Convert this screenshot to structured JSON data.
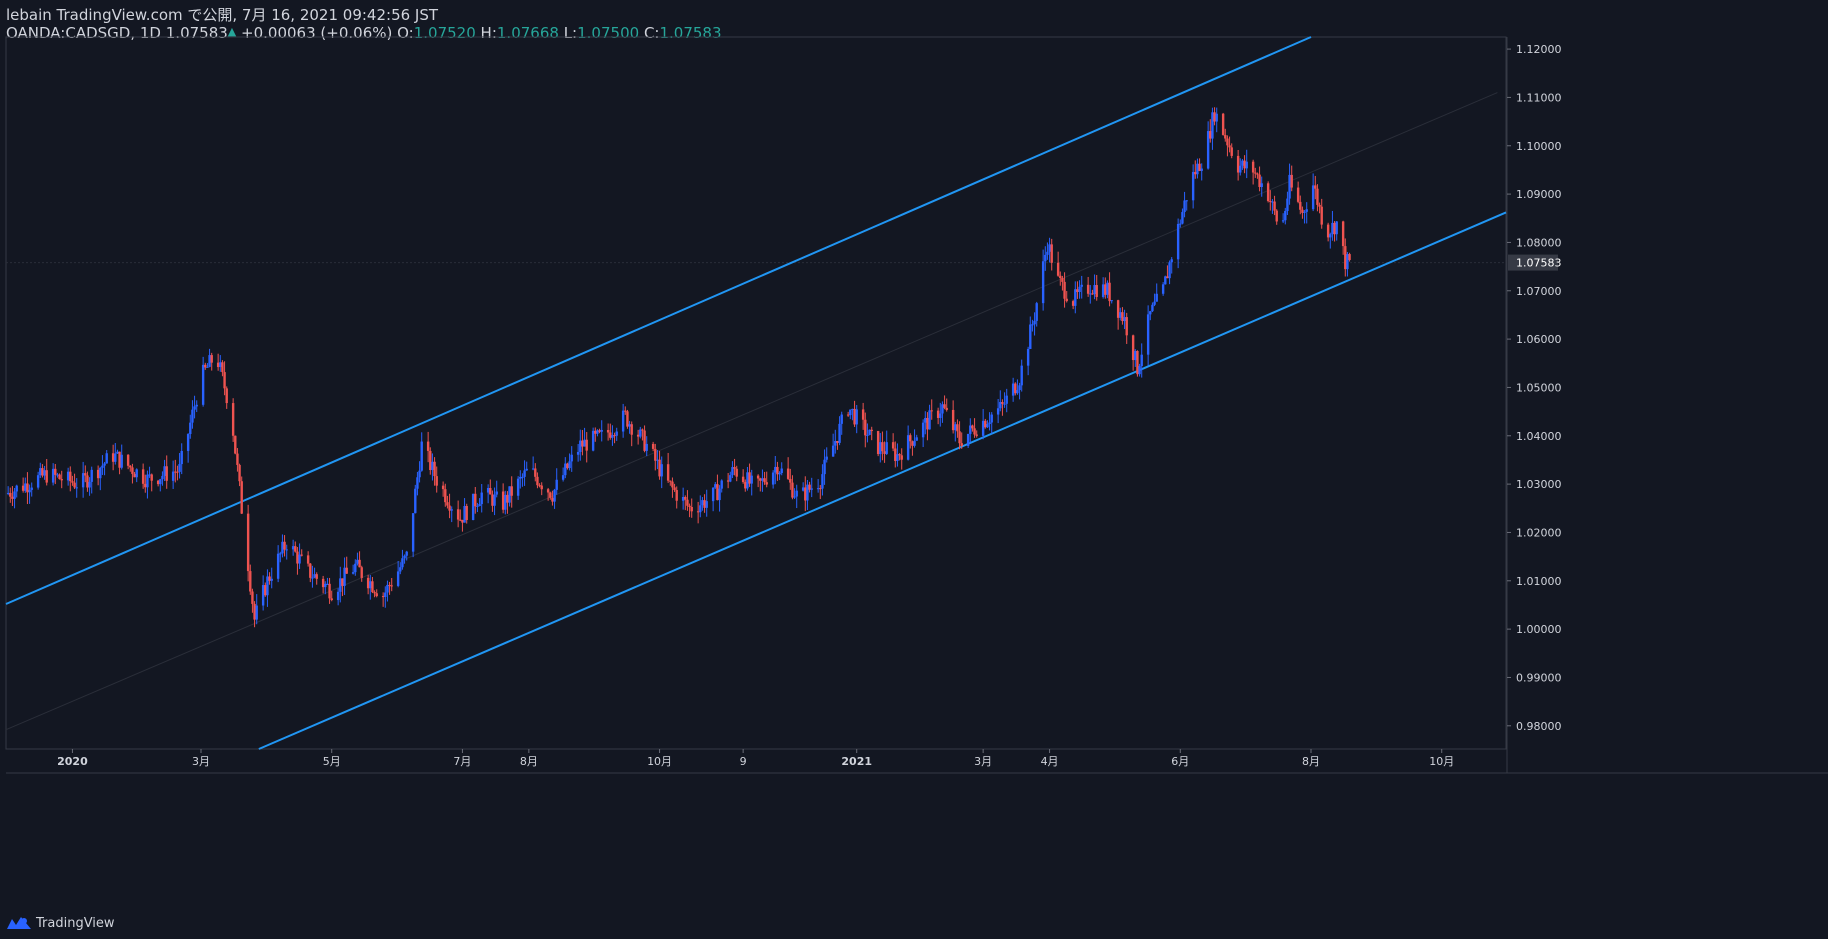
{
  "header": {
    "publish_line": "lebain TradingView.com で公開, 7月 16, 2021 09:42:56 JST",
    "symbol": "OANDA:CADSGD, 1D",
    "last": "1.07583",
    "change": "+0.00063 (+0.06%)",
    "o_label": "O:",
    "o_value": "1.07520",
    "h_label": "H:",
    "h_value": "1.07668",
    "l_label": "L:",
    "l_value": "1.07500",
    "c_label": "C:",
    "c_value": "1.07583"
  },
  "footer": {
    "brand": "TradingView",
    "logo_icon": "tradingview-logo-icon"
  },
  "colors": {
    "background": "#131722",
    "up": "#2962ff",
    "down": "#ef5350",
    "channel": "#2196f3",
    "text": "#d1d4dc",
    "change_up": "#26a69a"
  },
  "chart_data": {
    "type": "candlestick",
    "symbol": "OANDA:CADSGD",
    "interval": "1D",
    "last_price": "1.07583",
    "y_ticks": [
      "1.12000",
      "1.11000",
      "1.10000",
      "1.09000",
      "1.08000",
      "1.07000",
      "1.06000",
      "1.05000",
      "1.04000",
      "1.03000",
      "1.02000",
      "1.01000",
      "1.00000",
      "0.99000",
      "0.98000"
    ],
    "ylim": [
      0.9752,
      1.1225
    ],
    "x_ticks": [
      "2020",
      "3月",
      "5月",
      "7月",
      "8月",
      "10月",
      "9",
      "2021",
      "3月",
      "4月",
      "6月",
      "8月",
      "10月"
    ],
    "x_bold": [
      "2020",
      "2021"
    ],
    "date_range": [
      "2019-12-01",
      "2021-10-31"
    ],
    "tick_dates": [
      "2020-01-01",
      "2020-03-01",
      "2020-05-01",
      "2020-07-01",
      "2020-08-01",
      "2020-10-01",
      "2020-11-09",
      "2021-01-01",
      "2021-03-01",
      "2021-04-01",
      "2021-06-01",
      "2021-08-01",
      "2021-10-01"
    ],
    "price_path": [
      [
        "2019-12-01",
        1.028
      ],
      [
        "2019-12-20",
        1.032
      ],
      [
        "2020-01-05",
        1.03
      ],
      [
        "2020-01-20",
        1.036
      ],
      [
        "2020-02-05",
        1.031
      ],
      [
        "2020-02-20",
        1.033
      ],
      [
        "2020-03-01",
        1.052
      ],
      [
        "2020-03-08",
        1.057
      ],
      [
        "2020-03-15",
        1.045
      ],
      [
        "2020-03-20",
        1.025
      ],
      [
        "2020-03-26",
        1.002
      ],
      [
        "2020-04-01",
        1.01
      ],
      [
        "2020-04-10",
        1.018
      ],
      [
        "2020-04-20",
        1.012
      ],
      [
        "2020-05-01",
        1.008
      ],
      [
        "2020-05-12",
        1.013
      ],
      [
        "2020-05-25",
        1.007
      ],
      [
        "2020-06-05",
        1.015
      ],
      [
        "2020-06-12",
        1.038
      ],
      [
        "2020-06-20",
        1.03
      ],
      [
        "2020-06-30",
        1.023
      ],
      [
        "2020-07-10",
        1.028
      ],
      [
        "2020-07-20",
        1.026
      ],
      [
        "2020-08-01",
        1.033
      ],
      [
        "2020-08-12",
        1.028
      ],
      [
        "2020-08-25",
        1.038
      ],
      [
        "2020-09-05",
        1.04
      ],
      [
        "2020-09-15",
        1.044
      ],
      [
        "2020-09-25",
        1.038
      ],
      [
        "2020-10-05",
        1.03
      ],
      [
        "2020-10-15",
        1.025
      ],
      [
        "2020-10-25",
        1.027
      ],
      [
        "2020-11-05",
        1.033
      ],
      [
        "2020-11-15",
        1.029
      ],
      [
        "2020-11-25",
        1.034
      ],
      [
        "2020-12-05",
        1.027
      ],
      [
        "2020-12-15",
        1.031
      ],
      [
        "2020-12-28",
        1.046
      ],
      [
        "2021-01-10",
        1.038
      ],
      [
        "2021-01-20",
        1.036
      ],
      [
        "2021-02-01",
        1.042
      ],
      [
        "2021-02-10",
        1.046
      ],
      [
        "2021-02-18",
        1.039
      ],
      [
        "2021-03-01",
        1.043
      ],
      [
        "2021-03-10",
        1.046
      ],
      [
        "2021-03-18",
        1.052
      ],
      [
        "2021-03-25",
        1.065
      ],
      [
        "2021-03-31",
        1.08
      ],
      [
        "2021-04-05",
        1.072
      ],
      [
        "2021-04-12",
        1.068
      ],
      [
        "2021-04-20",
        1.071
      ],
      [
        "2021-04-28",
        1.07
      ],
      [
        "2021-05-06",
        1.064
      ],
      [
        "2021-05-12",
        1.054
      ],
      [
        "2021-05-18",
        1.065
      ],
      [
        "2021-05-24",
        1.07
      ],
      [
        "2021-05-31",
        1.083
      ],
      [
        "2021-06-06",
        1.093
      ],
      [
        "2021-06-12",
        1.098
      ],
      [
        "2021-06-17",
        1.107
      ],
      [
        "2021-06-22",
        1.102
      ],
      [
        "2021-06-28",
        1.096
      ],
      [
        "2021-07-05",
        1.095
      ],
      [
        "2021-07-12",
        1.09
      ],
      [
        "2021-07-18",
        1.082
      ],
      [
        "2021-07-22",
        1.092
      ],
      [
        "2021-07-28",
        1.086
      ],
      [
        "2021-08-02",
        1.092
      ],
      [
        "2021-08-08",
        1.082
      ],
      [
        "2021-08-13",
        1.084
      ],
      [
        "2021-08-17",
        1.076
      ],
      [
        "2021-08-19",
        1.0758
      ]
    ],
    "channel_lines": [
      {
        "name": "upper",
        "p1": [
          "2019-12-01",
          1.0052
        ],
        "p2": [
          "2021-08-01",
          1.1225
        ]
      },
      {
        "name": "middle",
        "p1": [
          "2019-12-01",
          0.9792
        ],
        "p2": [
          "2021-10-27",
          1.111
        ]
      },
      {
        "name": "lower",
        "p1": [
          "2020-03-28",
          0.9752
        ],
        "p2": [
          "2021-10-31",
          1.0862
        ]
      }
    ],
    "grid": false,
    "last_price_line": true
  }
}
